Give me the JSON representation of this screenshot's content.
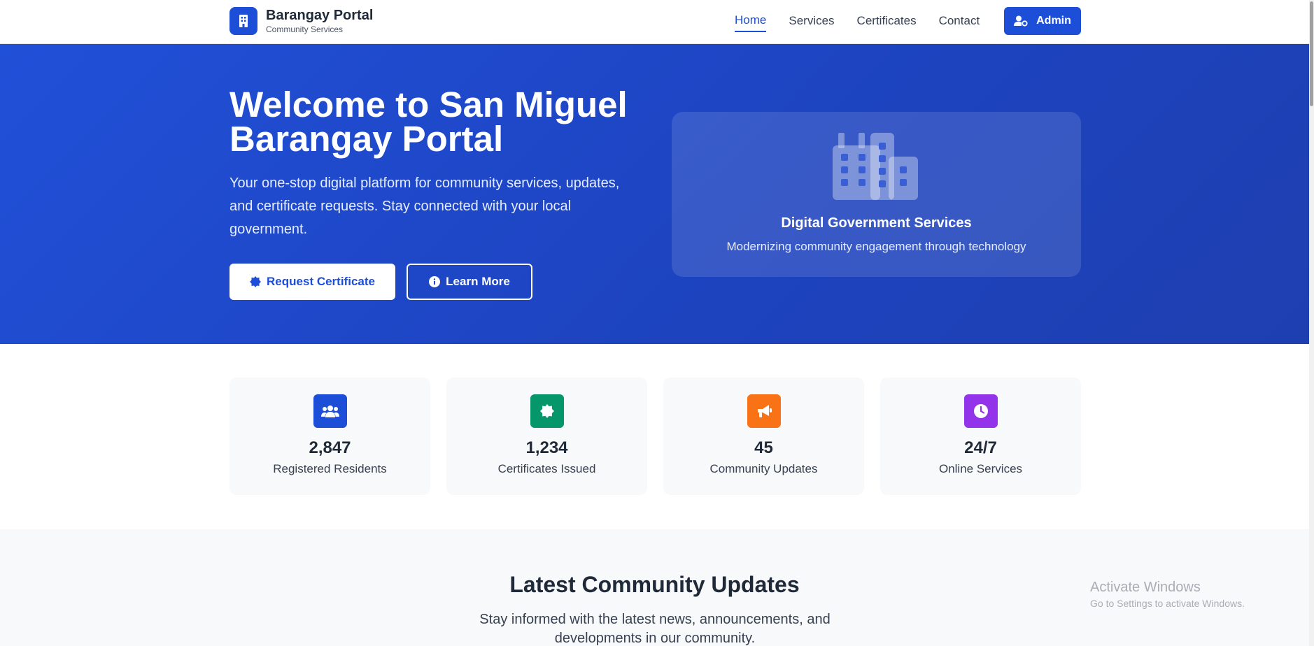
{
  "header": {
    "brand_title": "Barangay Portal",
    "brand_subtitle": "Community Services",
    "nav": [
      "Home",
      "Services",
      "Certificates",
      "Contact"
    ],
    "admin_label": "Admin"
  },
  "hero": {
    "title": "Welcome to San Miguel Barangay Portal",
    "description": "Your one-stop digital platform for community services, updates, and certificate requests. Stay connected with your local government.",
    "primary_button": "Request Certificate",
    "secondary_button": "Learn More",
    "card_title": "Digital Government Services",
    "card_subtitle": "Modernizing community engagement through technology"
  },
  "stats": [
    {
      "value": "2,847",
      "label": "Registered Residents",
      "color": "#1d4ed8",
      "icon": "users-icon"
    },
    {
      "value": "1,234",
      "label": "Certificates Issued",
      "color": "#059669",
      "icon": "certificate-icon"
    },
    {
      "value": "45",
      "label": "Community Updates",
      "color": "#f97316",
      "icon": "megaphone-icon"
    },
    {
      "value": "24/7",
      "label": "Online Services",
      "color": "#9333ea",
      "icon": "clock-icon"
    }
  ],
  "updates": {
    "title": "Latest Community Updates",
    "subtitle": "Stay informed with the latest news, announcements, and developments in our community."
  },
  "watermark": {
    "title": "Activate Windows",
    "subtitle": "Go to Settings to activate Windows."
  }
}
